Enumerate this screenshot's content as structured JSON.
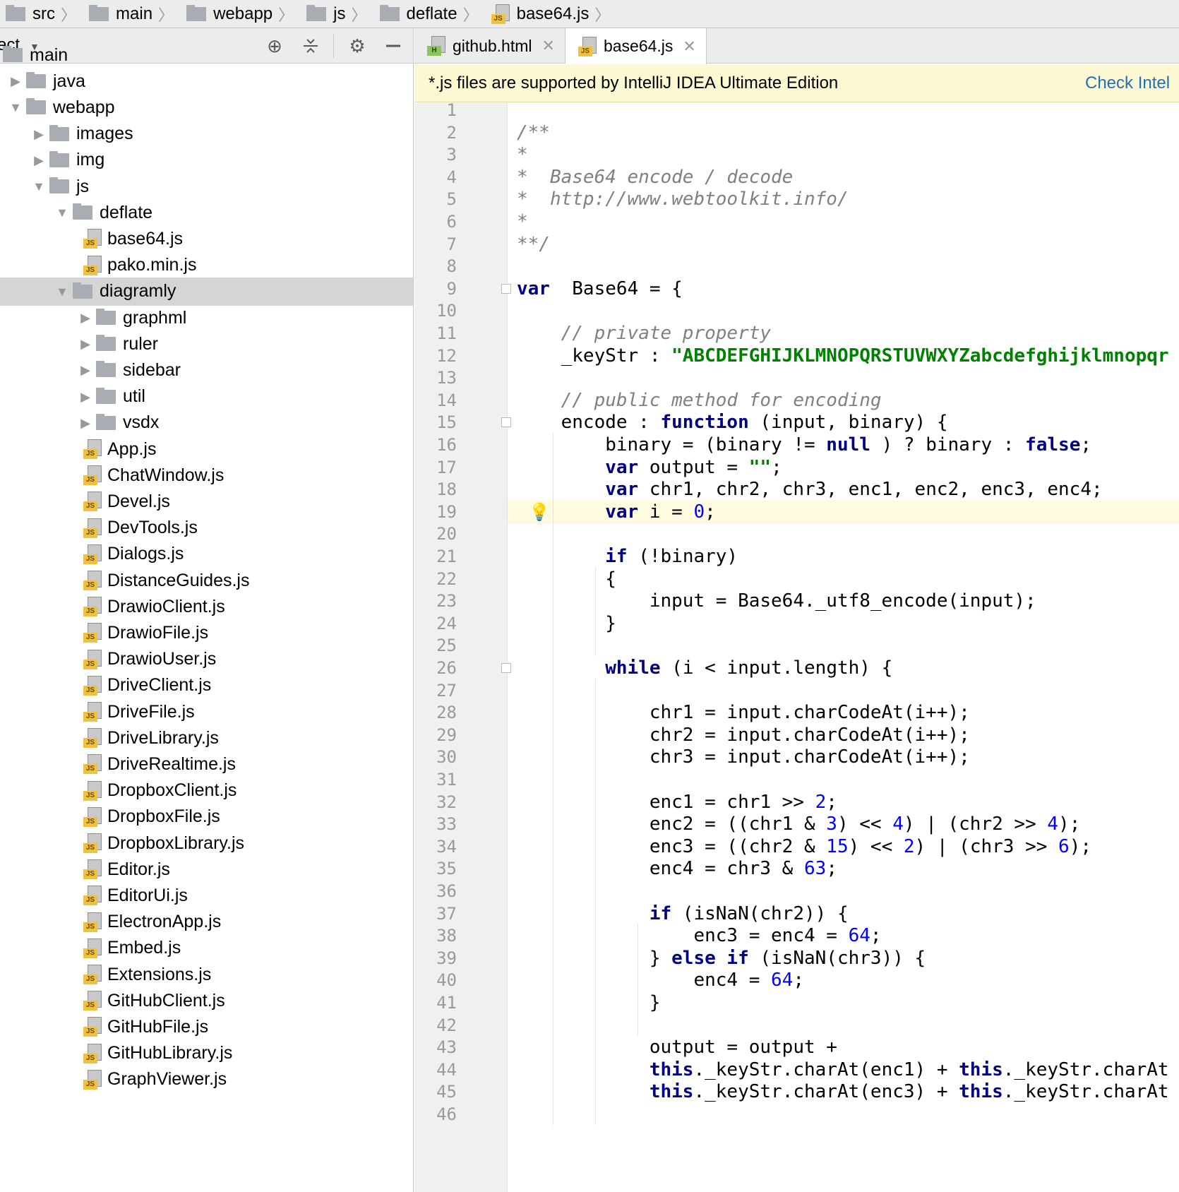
{
  "breadcrumb": [
    "src",
    "main",
    "webapp",
    "js",
    "deflate",
    "base64.js"
  ],
  "project": {
    "title": "ect",
    "tree": [
      {
        "label": "main",
        "type": "folder",
        "depth": 0
      },
      {
        "label": "java",
        "type": "folder",
        "depth": 1,
        "state": "collapsed"
      },
      {
        "label": "webapp",
        "type": "folder",
        "depth": 1,
        "state": "expanded"
      },
      {
        "label": "images",
        "type": "folder",
        "depth": 2,
        "state": "collapsed"
      },
      {
        "label": "img",
        "type": "folder",
        "depth": 2,
        "state": "collapsed"
      },
      {
        "label": "js",
        "type": "folder",
        "depth": 2,
        "state": "expanded"
      },
      {
        "label": "deflate",
        "type": "folder",
        "depth": 3,
        "state": "expanded"
      },
      {
        "label": "base64.js",
        "type": "js",
        "depth": 4
      },
      {
        "label": "pako.min.js",
        "type": "js",
        "depth": 4
      },
      {
        "label": "diagramly",
        "type": "folder",
        "depth": 3,
        "state": "expanded",
        "selected": true
      },
      {
        "label": "graphml",
        "type": "folder",
        "depth": 4,
        "state": "collapsed"
      },
      {
        "label": "ruler",
        "type": "folder",
        "depth": 4,
        "state": "collapsed"
      },
      {
        "label": "sidebar",
        "type": "folder",
        "depth": 4,
        "state": "collapsed"
      },
      {
        "label": "util",
        "type": "folder",
        "depth": 4,
        "state": "collapsed"
      },
      {
        "label": "vsdx",
        "type": "folder",
        "depth": 4,
        "state": "collapsed"
      },
      {
        "label": "App.js",
        "type": "js",
        "depth": 4
      },
      {
        "label": "ChatWindow.js",
        "type": "js",
        "depth": 4
      },
      {
        "label": "Devel.js",
        "type": "js",
        "depth": 4
      },
      {
        "label": "DevTools.js",
        "type": "js",
        "depth": 4
      },
      {
        "label": "Dialogs.js",
        "type": "js",
        "depth": 4
      },
      {
        "label": "DistanceGuides.js",
        "type": "js",
        "depth": 4
      },
      {
        "label": "DrawioClient.js",
        "type": "js",
        "depth": 4
      },
      {
        "label": "DrawioFile.js",
        "type": "js",
        "depth": 4
      },
      {
        "label": "DrawioUser.js",
        "type": "js",
        "depth": 4
      },
      {
        "label": "DriveClient.js",
        "type": "js",
        "depth": 4
      },
      {
        "label": "DriveFile.js",
        "type": "js",
        "depth": 4
      },
      {
        "label": "DriveLibrary.js",
        "type": "js",
        "depth": 4
      },
      {
        "label": "DriveRealtime.js",
        "type": "js",
        "depth": 4
      },
      {
        "label": "DropboxClient.js",
        "type": "js",
        "depth": 4
      },
      {
        "label": "DropboxFile.js",
        "type": "js",
        "depth": 4
      },
      {
        "label": "DropboxLibrary.js",
        "type": "js",
        "depth": 4
      },
      {
        "label": "Editor.js",
        "type": "js",
        "depth": 4
      },
      {
        "label": "EditorUi.js",
        "type": "js",
        "depth": 4
      },
      {
        "label": "ElectronApp.js",
        "type": "js",
        "depth": 4
      },
      {
        "label": "Embed.js",
        "type": "js",
        "depth": 4
      },
      {
        "label": "Extensions.js",
        "type": "js",
        "depth": 4
      },
      {
        "label": "GitHubClient.js",
        "type": "js",
        "depth": 4
      },
      {
        "label": "GitHubFile.js",
        "type": "js",
        "depth": 4
      },
      {
        "label": "GitHubLibrary.js",
        "type": "js",
        "depth": 4
      },
      {
        "label": "GraphViewer.js",
        "type": "js",
        "depth": 4
      }
    ]
  },
  "tabs": [
    {
      "label": "github.html",
      "icon": "html-file-icon",
      "active": false
    },
    {
      "label": "base64.js",
      "icon": "js-file-icon",
      "active": true
    }
  ],
  "banner": {
    "text": "*.js files are supported by IntelliJ IDEA Ultimate Edition",
    "link": "Check Intel"
  },
  "editor": {
    "current_line": 19,
    "lines": [
      {
        "n": "1",
        "tokens": []
      },
      {
        "n": "2",
        "tokens": [
          [
            "cm",
            "/**"
          ]
        ]
      },
      {
        "n": "3",
        "tokens": [
          [
            "cm",
            "*"
          ]
        ]
      },
      {
        "n": "4",
        "tokens": [
          [
            "cm",
            "*  Base64 encode / decode"
          ]
        ]
      },
      {
        "n": "5",
        "tokens": [
          [
            "cm",
            "*  http://www.webtoolkit.info/"
          ]
        ]
      },
      {
        "n": "6",
        "tokens": [
          [
            "cm",
            "*"
          ]
        ]
      },
      {
        "n": "7",
        "tokens": [
          [
            "cm",
            "**/"
          ]
        ]
      },
      {
        "n": "8",
        "tokens": []
      },
      {
        "n": "9",
        "tokens": [
          [
            "kw",
            "var"
          ],
          [
            "",
            "  Base64 = {"
          ]
        ]
      },
      {
        "n": "10",
        "tokens": []
      },
      {
        "n": "11",
        "tokens": [
          [
            "",
            "    "
          ],
          [
            "cm",
            "// private property"
          ]
        ]
      },
      {
        "n": "12",
        "tokens": [
          [
            "",
            "    _keyStr : "
          ],
          [
            "str",
            "\"ABCDEFGHIJKLMNOPQRSTUVWXYZabcdefghijklmnopqr"
          ]
        ]
      },
      {
        "n": "13",
        "tokens": []
      },
      {
        "n": "14",
        "tokens": [
          [
            "",
            "    "
          ],
          [
            "cm",
            "// public method for encoding"
          ]
        ]
      },
      {
        "n": "15",
        "tokens": [
          [
            "",
            "    encode : "
          ],
          [
            "kw",
            "function"
          ],
          [
            "",
            " (input, binary) {"
          ]
        ]
      },
      {
        "n": "16",
        "tokens": [
          [
            "",
            "        binary = (binary != "
          ],
          [
            "kw",
            "null"
          ],
          [
            "",
            " ) ? binary : "
          ],
          [
            "kw",
            "false"
          ],
          [
            "",
            ";"
          ]
        ]
      },
      {
        "n": "17",
        "tokens": [
          [
            "",
            "        "
          ],
          [
            "kw",
            "var"
          ],
          [
            "",
            " output = "
          ],
          [
            "str",
            "\"\""
          ],
          [
            "",
            ";"
          ]
        ]
      },
      {
        "n": "18",
        "tokens": [
          [
            "",
            "        "
          ],
          [
            "kw",
            "var"
          ],
          [
            "",
            " chr1, chr2, chr3, enc1, enc2, enc3, enc4;"
          ]
        ]
      },
      {
        "n": "19",
        "tokens": [
          [
            "",
            "        "
          ],
          [
            "kw",
            "var"
          ],
          [
            "",
            " i = "
          ],
          [
            "num",
            "0"
          ],
          [
            "",
            ";"
          ]
        ]
      },
      {
        "n": "20",
        "tokens": []
      },
      {
        "n": "21",
        "tokens": [
          [
            "",
            "        "
          ],
          [
            "kw",
            "if"
          ],
          [
            "",
            " (!binary)"
          ]
        ]
      },
      {
        "n": "22",
        "tokens": [
          [
            "",
            "        {"
          ]
        ]
      },
      {
        "n": "23",
        "tokens": [
          [
            "",
            "            input = Base64._utf8_encode(input);"
          ]
        ]
      },
      {
        "n": "24",
        "tokens": [
          [
            "",
            "        }"
          ]
        ]
      },
      {
        "n": "25",
        "tokens": []
      },
      {
        "n": "26",
        "tokens": [
          [
            "",
            "        "
          ],
          [
            "kw",
            "while"
          ],
          [
            "",
            " (i < input.length) {"
          ]
        ]
      },
      {
        "n": "27",
        "tokens": []
      },
      {
        "n": "28",
        "tokens": [
          [
            "",
            "            chr1 = input.charCodeAt(i++);"
          ]
        ]
      },
      {
        "n": "29",
        "tokens": [
          [
            "",
            "            chr2 = input.charCodeAt(i++);"
          ]
        ]
      },
      {
        "n": "30",
        "tokens": [
          [
            "",
            "            chr3 = input.charCodeAt(i++);"
          ]
        ]
      },
      {
        "n": "31",
        "tokens": []
      },
      {
        "n": "32",
        "tokens": [
          [
            "",
            "            enc1 = chr1 >> "
          ],
          [
            "num",
            "2"
          ],
          [
            "",
            ";"
          ]
        ]
      },
      {
        "n": "33",
        "tokens": [
          [
            "",
            "            enc2 = ((chr1 & "
          ],
          [
            "num",
            "3"
          ],
          [
            "",
            ") << "
          ],
          [
            "num",
            "4"
          ],
          [
            "",
            ") | (chr2 >> "
          ],
          [
            "num",
            "4"
          ],
          [
            "",
            ");"
          ]
        ]
      },
      {
        "n": "34",
        "tokens": [
          [
            "",
            "            enc3 = ((chr2 & "
          ],
          [
            "num",
            "15"
          ],
          [
            "",
            ") << "
          ],
          [
            "num",
            "2"
          ],
          [
            "",
            ") | (chr3 >> "
          ],
          [
            "num",
            "6"
          ],
          [
            "",
            ");"
          ]
        ]
      },
      {
        "n": "35",
        "tokens": [
          [
            "",
            "            enc4 = chr3 & "
          ],
          [
            "num",
            "63"
          ],
          [
            "",
            ";"
          ]
        ]
      },
      {
        "n": "36",
        "tokens": []
      },
      {
        "n": "37",
        "tokens": [
          [
            "",
            "            "
          ],
          [
            "kw",
            "if"
          ],
          [
            "",
            " (isNaN(chr2)) {"
          ]
        ]
      },
      {
        "n": "38",
        "tokens": [
          [
            "",
            "                enc3 = enc4 = "
          ],
          [
            "num",
            "64"
          ],
          [
            "",
            ";"
          ]
        ]
      },
      {
        "n": "39",
        "tokens": [
          [
            "",
            "            } "
          ],
          [
            "kw",
            "else if"
          ],
          [
            "",
            " (isNaN(chr3)) {"
          ]
        ]
      },
      {
        "n": "40",
        "tokens": [
          [
            "",
            "                enc4 = "
          ],
          [
            "num",
            "64"
          ],
          [
            "",
            ";"
          ]
        ]
      },
      {
        "n": "41",
        "tokens": [
          [
            "",
            "            }"
          ]
        ]
      },
      {
        "n": "42",
        "tokens": []
      },
      {
        "n": "43",
        "tokens": [
          [
            "",
            "            output = output +"
          ]
        ]
      },
      {
        "n": "44",
        "tokens": [
          [
            "",
            "            "
          ],
          [
            "kw",
            "this"
          ],
          [
            "",
            "._keyStr.charAt(enc1) + "
          ],
          [
            "kw",
            "this"
          ],
          [
            "",
            "._keyStr.charAt"
          ]
        ]
      },
      {
        "n": "45",
        "tokens": [
          [
            "",
            "            "
          ],
          [
            "kw",
            "this"
          ],
          [
            "",
            "._keyStr.charAt(enc3) + "
          ],
          [
            "kw",
            "this"
          ],
          [
            "",
            "._keyStr.charAt"
          ]
        ]
      },
      {
        "n": "46",
        "tokens": []
      }
    ]
  }
}
